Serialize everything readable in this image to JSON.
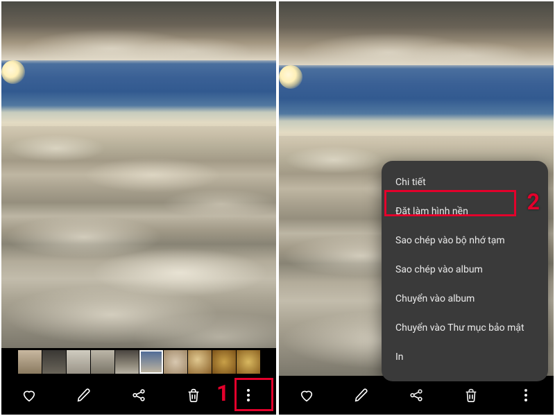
{
  "annotations": {
    "step1": "1",
    "step2": "2",
    "highlight_color": "#e3002b"
  },
  "toolbar": {
    "favorite": "favorite",
    "edit": "edit",
    "share": "share",
    "delete": "delete",
    "more": "more"
  },
  "menu": {
    "items": [
      {
        "label": "Chi tiết"
      },
      {
        "label": "Đặt làm hình nền"
      },
      {
        "label": "Sao chép vào bộ nhớ tạm"
      },
      {
        "label": "Sao chép vào album"
      },
      {
        "label": "Chuyển vào album"
      },
      {
        "label": "Chuyển vào Thư mục bảo mật"
      },
      {
        "label": "In"
      }
    ]
  },
  "thumbnails": {
    "count": 10,
    "selected_index": 5
  }
}
